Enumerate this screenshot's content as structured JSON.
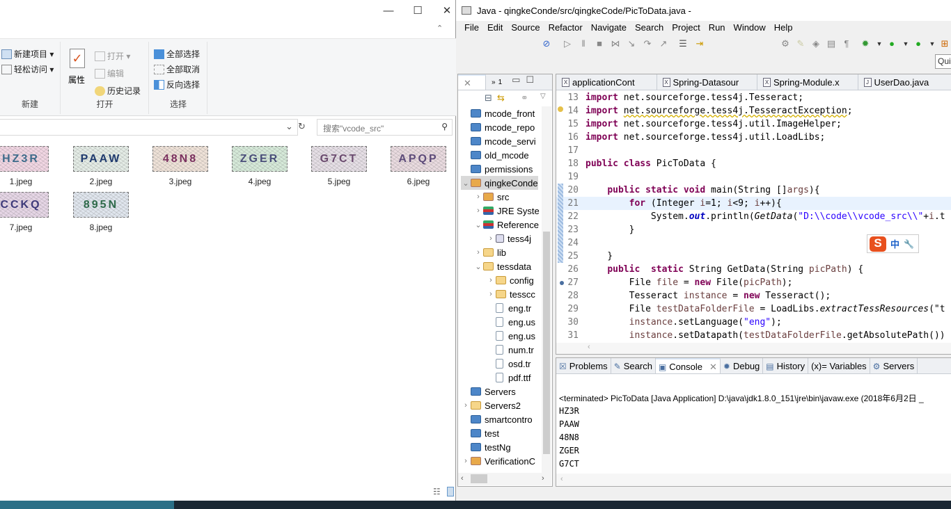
{
  "explorer": {
    "ribbon": {
      "groups": [
        {
          "label": "新建",
          "items": [
            "新建项目 ▾",
            "轻松访问 ▾"
          ]
        },
        {
          "label": "打开",
          "big": "属性",
          "items": [
            "打开 ▾",
            "编辑",
            "历史记录"
          ]
        },
        {
          "label": "选择",
          "items": [
            "全部选择",
            "全部取消",
            "反向选择"
          ]
        }
      ]
    },
    "search_placeholder": "搜索\"vcode_src\"",
    "files": [
      {
        "name": "1.jpeg",
        "code": "HZ3R",
        "color": "#3d6b8a",
        "bg": "#f1d6e3"
      },
      {
        "name": "2.jpeg",
        "code": "PAAW",
        "color": "#1f3a6e",
        "bg": "#e4ece6"
      },
      {
        "name": "3.jpeg",
        "code": "48N8",
        "color": "#7a2f5e",
        "bg": "#efe2d8"
      },
      {
        "name": "4.jpeg",
        "code": "ZGER",
        "color": "#4a4e7a",
        "bg": "#d6ead9"
      },
      {
        "name": "5.jpeg",
        "code": "G7CT",
        "color": "#6a4a6e",
        "bg": "#e6dfe6"
      },
      {
        "name": "6.jpeg",
        "code": "APQP",
        "color": "#5e4c7a",
        "bg": "#eadbe0"
      },
      {
        "name": "7.jpeg",
        "code": "CCKQ",
        "color": "#3e3a7a",
        "bg": "#e6d6e6"
      },
      {
        "name": "8.jpeg",
        "code": "895N",
        "color": "#2e6a4a",
        "bg": "#e0e6ee"
      }
    ]
  },
  "eclipse": {
    "title": "Java - qingkeConde/src/qingkeCode/PicToData.java -",
    "menu": [
      "File",
      "Edit",
      "Source",
      "Refactor",
      "Navigate",
      "Search",
      "Project",
      "Run",
      "Window",
      "Help"
    ],
    "quick_access": "Qui",
    "explorer_tab_count": "1",
    "editor_tabs": [
      "applicationCont",
      "Spring-Datasour",
      "Spring-Module.x",
      "UserDao.java"
    ],
    "tree": [
      {
        "label": "mcode_front",
        "icon": "proj",
        "depth": 0,
        "tw": ""
      },
      {
        "label": "mcode_repo",
        "icon": "proj",
        "depth": 0,
        "tw": ""
      },
      {
        "label": "mcode_servi",
        "icon": "proj",
        "depth": 0,
        "tw": ""
      },
      {
        "label": "old_mcode",
        "icon": "proj",
        "depth": 0,
        "tw": ""
      },
      {
        "label": "permissions",
        "icon": "proj",
        "depth": 0,
        "tw": ""
      },
      {
        "label": "qingkeConde",
        "icon": "pkg",
        "depth": 0,
        "tw": "⌄",
        "selected": true
      },
      {
        "label": "src",
        "icon": "pkg",
        "depth": 1,
        "tw": "›"
      },
      {
        "label": "JRE Syste",
        "icon": "lib",
        "depth": 1,
        "tw": "›"
      },
      {
        "label": "Reference",
        "icon": "lib",
        "depth": 1,
        "tw": "⌄"
      },
      {
        "label": "tess4j",
        "icon": "jar",
        "depth": 2,
        "tw": "›"
      },
      {
        "label": "lib",
        "icon": "fold",
        "depth": 1,
        "tw": "›"
      },
      {
        "label": "tessdata",
        "icon": "fold",
        "depth": 1,
        "tw": "⌄"
      },
      {
        "label": "config",
        "icon": "fold",
        "depth": 2,
        "tw": "›"
      },
      {
        "label": "tesscc",
        "icon": "fold",
        "depth": 2,
        "tw": "›"
      },
      {
        "label": "eng.tr",
        "icon": "file",
        "depth": 2,
        "tw": ""
      },
      {
        "label": "eng.us",
        "icon": "file",
        "depth": 2,
        "tw": ""
      },
      {
        "label": "eng.us",
        "icon": "file",
        "depth": 2,
        "tw": ""
      },
      {
        "label": "num.tr",
        "icon": "file",
        "depth": 2,
        "tw": ""
      },
      {
        "label": "osd.tr",
        "icon": "file",
        "depth": 2,
        "tw": ""
      },
      {
        "label": "pdf.ttf",
        "icon": "file",
        "depth": 2,
        "tw": ""
      },
      {
        "label": "Servers",
        "icon": "proj",
        "depth": 0,
        "tw": ""
      },
      {
        "label": "Servers2",
        "icon": "fold",
        "depth": 0,
        "tw": "›"
      },
      {
        "label": "smartcontro",
        "icon": "proj",
        "depth": 0,
        "tw": ""
      },
      {
        "label": "test",
        "icon": "proj",
        "depth": 0,
        "tw": ""
      },
      {
        "label": "testNg",
        "icon": "proj",
        "depth": 0,
        "tw": ""
      },
      {
        "label": "VerificationC",
        "icon": "pkg",
        "depth": 0,
        "tw": "›"
      }
    ],
    "code": [
      {
        "n": "13",
        "t": [
          [
            "kw",
            "import"
          ],
          [
            "",
            " net.sourceforge.tess4j.Tesseract;"
          ]
        ]
      },
      {
        "n": "14",
        "t": [
          [
            "kw",
            "import"
          ],
          [
            "",
            " "
          ],
          [
            "warn",
            "net.sourceforge.tess4j.TesseractException"
          ],
          [
            "",
            ";"
          ]
        ]
      },
      {
        "n": "15",
        "t": [
          [
            "kw",
            "import"
          ],
          [
            "",
            " net.sourceforge.tess4j.util.ImageHelper;"
          ]
        ]
      },
      {
        "n": "16",
        "t": [
          [
            "kw",
            "import"
          ],
          [
            "",
            " net.sourceforge.tess4j.util.LoadLibs;"
          ]
        ]
      },
      {
        "n": "17",
        "t": []
      },
      {
        "n": "18",
        "t": [
          [
            "kw",
            "public class"
          ],
          [
            "",
            " PicToData {"
          ]
        ]
      },
      {
        "n": "19",
        "t": []
      },
      {
        "n": "20",
        "t": [
          [
            "",
            "    "
          ],
          [
            "kw",
            "public static void"
          ],
          [
            "",
            " main(String []"
          ],
          [
            "var",
            "args"
          ],
          [
            "",
            "){"
          ]
        ]
      },
      {
        "n": "21",
        "t": [
          [
            "",
            "        "
          ],
          [
            "kw",
            "for"
          ],
          [
            "",
            " (Integer "
          ],
          [
            "var",
            "i"
          ],
          [
            "",
            "=1; "
          ],
          [
            "var",
            "i"
          ],
          [
            "",
            "<9; "
          ],
          [
            "var",
            "i"
          ],
          [
            "",
            "++){"
          ]
        ],
        "current": true
      },
      {
        "n": "22",
        "t": [
          [
            "",
            "            System."
          ],
          [
            "fld",
            "out"
          ],
          [
            "",
            ".println("
          ],
          [
            "it",
            "GetData"
          ],
          [
            "",
            "("
          ],
          [
            "str",
            "\"D:\\\\code\\\\vcode_src\\\\\""
          ],
          [
            "",
            "+"
          ],
          [
            "var",
            "i"
          ],
          [
            "",
            ".t"
          ]
        ]
      },
      {
        "n": "23",
        "t": [
          [
            "",
            "        }"
          ]
        ]
      },
      {
        "n": "24",
        "t": []
      },
      {
        "n": "25",
        "t": [
          [
            "",
            "    }"
          ]
        ]
      },
      {
        "n": "26",
        "t": [
          [
            "",
            "    "
          ],
          [
            "kw",
            "public"
          ],
          [
            "",
            "  "
          ],
          [
            "kw",
            "static"
          ],
          [
            "",
            " String GetData(String "
          ],
          [
            "var",
            "picPath"
          ],
          [
            "",
            ") {"
          ]
        ]
      },
      {
        "n": "27",
        "t": [
          [
            "",
            "        File "
          ],
          [
            "var",
            "file"
          ],
          [
            "",
            " = "
          ],
          [
            "kw",
            "new"
          ],
          [
            "",
            " File("
          ],
          [
            "var",
            "picPath"
          ],
          [
            "",
            ");"
          ]
        ]
      },
      {
        "n": "28",
        "t": [
          [
            "",
            "        Tesseract "
          ],
          [
            "var",
            "instance"
          ],
          [
            "",
            " = "
          ],
          [
            "kw",
            "new"
          ],
          [
            "",
            " Tesseract();"
          ]
        ]
      },
      {
        "n": "29",
        "t": [
          [
            "",
            "        File "
          ],
          [
            "var",
            "testDataFolderFile"
          ],
          [
            "",
            " = LoadLibs."
          ],
          [
            "it",
            "extractTessResources"
          ],
          [
            "",
            "(\"t"
          ]
        ]
      },
      {
        "n": "30",
        "t": [
          [
            "",
            "        "
          ],
          [
            "var",
            "instance"
          ],
          [
            "",
            ".setLanguage("
          ],
          [
            "str",
            "\"eng\""
          ],
          [
            "",
            ");"
          ]
        ]
      },
      {
        "n": "31",
        "t": [
          [
            "",
            "        "
          ],
          [
            "var",
            "instance"
          ],
          [
            "",
            ".setDatapath("
          ],
          [
            "var",
            "testDataFolderFile"
          ],
          [
            "",
            ".getAbsolutePath())"
          ]
        ]
      }
    ],
    "ime": {
      "logo": "S",
      "mode": "中",
      "tool": "🔧"
    },
    "bottom_tabs": [
      "Problems",
      "Search",
      "Console",
      "Debug",
      "History",
      "(x)= Variables",
      "Servers"
    ],
    "console": {
      "header": "<terminated> PicToData [Java Application] D:\\java\\jdk1.8.0_151\\jre\\bin\\javaw.exe (2018年6月2日 _",
      "lines": [
        "HZ3R",
        "PAAW",
        "48N8",
        "ZGER",
        "G7CT"
      ]
    }
  }
}
